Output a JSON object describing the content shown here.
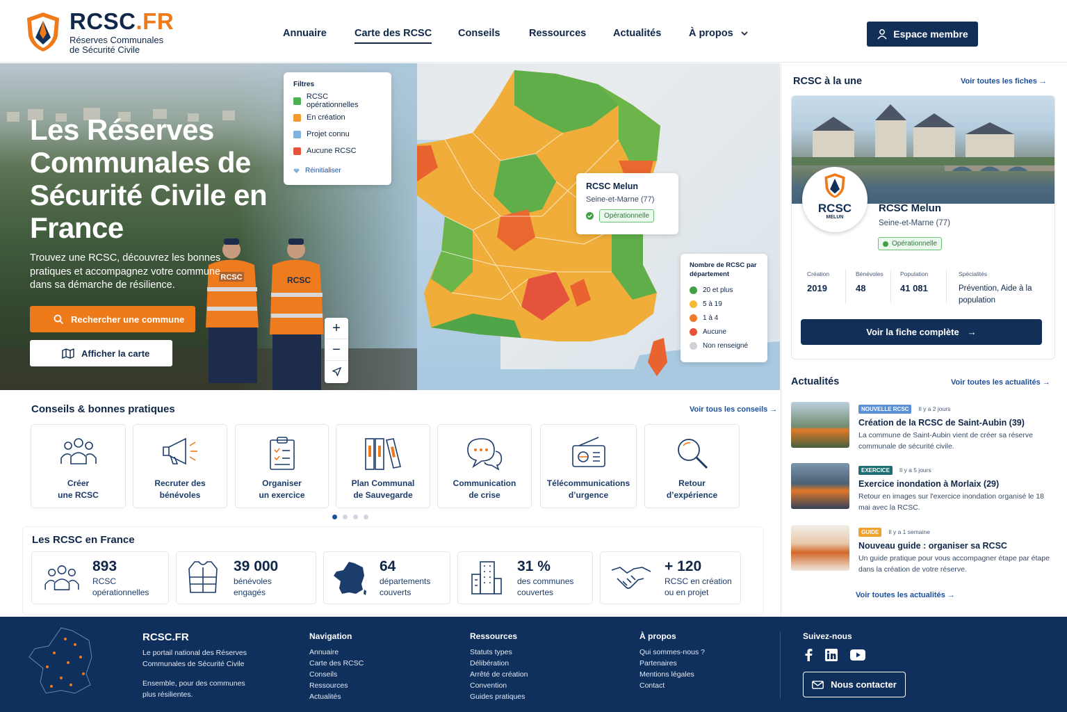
{
  "brand": {
    "name_main": "RCSC",
    "name_suffix": ".FR",
    "tagline_1": "Réserves Communales",
    "tagline_2": "de Sécurité Civile"
  },
  "nav": {
    "items": [
      {
        "label": "Annuaire"
      },
      {
        "label": "Carte des RCSC"
      },
      {
        "label": "Conseils"
      },
      {
        "label": "Ressources"
      },
      {
        "label": "Actualités"
      },
      {
        "label": "À propos"
      }
    ],
    "member_button": "Espace membre"
  },
  "hero": {
    "title": "Les Réserves Communales de Sécurité Civile en France",
    "subtitle": "Trouvez une RCSC, découvrez les bonnes pratiques et accompagnez votre commune dans sa démarche de résilience.",
    "search_button": "Rechercher une commune",
    "map_button": "Afficher la carte",
    "vest_text": "RCSC"
  },
  "map": {
    "filters": {
      "title": "Filtres",
      "items": [
        {
          "label": "RCSC opérationnelles",
          "color": "#4caf50"
        },
        {
          "label": "En création",
          "color": "#f29a2e"
        },
        {
          "label": "Projet connu",
          "color": "#7fb3de"
        },
        {
          "label": "Aucune RCSC",
          "color": "#e5533c"
        }
      ],
      "reset": "Réinitialiser"
    },
    "popup": {
      "name": "RCSC Melun",
      "dept": "Seine-et-Marne (77)",
      "status": "Opérationnelle"
    },
    "legend": {
      "title": "Nombre de RCSC par département",
      "items": [
        {
          "label": "20 et plus",
          "color": "#3fa045"
        },
        {
          "label": "5 à 19",
          "color": "#f6b935"
        },
        {
          "label": "1 à 4",
          "color": "#ef7a2a"
        },
        {
          "label": "Aucune",
          "color": "#e5533c"
        },
        {
          "label": "Non renseigné",
          "color": "#cfd3d8"
        }
      ]
    },
    "zoom_in": "+",
    "zoom_out": "−"
  },
  "featured": {
    "heading": "RCSC à la une",
    "see_all": "Voir toutes les fiches",
    "logo_text": "RCSC",
    "logo_sub": "MELUN",
    "name": "RCSC Melun",
    "dept": "Seine-et-Marne (77)",
    "status": "Opérationnelle",
    "stats": [
      {
        "label": "Création",
        "value": "2019"
      },
      {
        "label": "Bénévoles",
        "value": "48"
      },
      {
        "label": "Population",
        "value": "41 081"
      },
      {
        "label": "Spécialités",
        "value": "Prévention, Aide à la population"
      }
    ],
    "cta": "Voir la fiche complète"
  },
  "news": {
    "heading": "Actualités",
    "see_all": "Voir toutes les actualités",
    "footer_link": "Voir toutes les actualités",
    "items": [
      {
        "tag": "NOUVELLE RCSC",
        "tag_color": "#5b8fd6",
        "when": "Il y a 2 jours",
        "title": "Création de la RCSC de Saint-Aubin (39)",
        "desc": "La commune de Saint-Aubin vient de créer sa réserve communale de sécurité civile."
      },
      {
        "tag": "EXERCICE",
        "tag_color": "#1e6f73",
        "when": "Il y a 5 jours",
        "title": "Exercice inondation à Morlaix (29)",
        "desc": "Retour en images sur l'exercice inondation organisé le 18 mai avec la RCSC."
      },
      {
        "tag": "GUIDE",
        "tag_color": "#f0a12c",
        "when": "Il y a 1 semaine",
        "title": "Nouveau guide : organiser sa RCSC",
        "desc": "Un guide pratique pour vous accompagner étape par étape dans la création de votre réserve."
      }
    ]
  },
  "tips": {
    "heading": "Conseils & bonnes pratiques",
    "see_all": "Voir tous les conseils",
    "items": [
      {
        "line1": "Créer",
        "line2": "une RCSC",
        "icon": "people-icon"
      },
      {
        "line1": "Recruter des",
        "line2": "bénévoles",
        "icon": "megaphone-icon"
      },
      {
        "line1": "Organiser",
        "line2": "un exercice",
        "icon": "clipboard-icon"
      },
      {
        "line1": "Plan Communal",
        "line2": "de Sauvegarde",
        "icon": "binders-icon"
      },
      {
        "line1": "Communication",
        "line2": "de crise",
        "icon": "chat-icon"
      },
      {
        "line1": "Télécommunications",
        "line2": "d’urgence",
        "icon": "radio-icon"
      },
      {
        "line1": "Retour",
        "line2": "d’expérience",
        "icon": "magnifier-icon"
      }
    ]
  },
  "stats": {
    "heading": "Les RCSC en France",
    "items": [
      {
        "num": "893",
        "cap1": "RCSC",
        "cap2": "opérationnelles",
        "icon": "people-icon"
      },
      {
        "num": "39 000",
        "cap1": "bénévoles",
        "cap2": "engagés",
        "icon": "vest-icon"
      },
      {
        "num": "64",
        "cap1": "départements",
        "cap2": "couverts",
        "icon": "france-map-icon"
      },
      {
        "num": "31 %",
        "cap1": "des communes",
        "cap2": "couvertes",
        "icon": "building-icon"
      },
      {
        "num": "+ 120",
        "cap1": "RCSC en création",
        "cap2": "ou en projet",
        "icon": "handshake-icon"
      }
    ]
  },
  "footer": {
    "brand": "RCSC.FR",
    "desc_1": "Le portail national des Réserves",
    "desc_2": "Communales de Sécurité Civile",
    "motto_1": "Ensemble, pour des communes",
    "motto_2": "plus résilientes.",
    "cols": [
      {
        "title": "Navigation",
        "links": [
          "Annuaire",
          "Carte des RCSC",
          "Conseils",
          "Ressources",
          "Actualités"
        ]
      },
      {
        "title": "Ressources",
        "links": [
          "Statuts types",
          "Délibération",
          "Arrêté de création",
          "Convention",
          "Guides pratiques"
        ]
      },
      {
        "title": "À propos",
        "links": [
          "Qui sommes-nous ?",
          "Partenaires",
          "Mentions légales",
          "Contact"
        ]
      }
    ],
    "follow": "Suivez-nous",
    "contact": "Nous contacter"
  },
  "colors": {
    "navy": "#123057",
    "orange": "#ef7a1a",
    "green": "#4caf50"
  }
}
